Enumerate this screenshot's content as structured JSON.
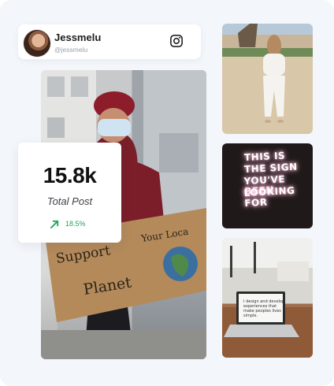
{
  "profile": {
    "name": "Jessmelu",
    "handle": "@jessmelu",
    "social_icon": "instagram-icon"
  },
  "stats": {
    "value": "15.8k",
    "label": "Total Post",
    "change": "18.5%",
    "trend_icon": "trend-up-arrow-icon",
    "trend_color": "#22a55a"
  },
  "gallery": {
    "neon_sign_lines": [
      "THIS IS",
      "THE SIGN",
      "YOU'VE BEEN",
      "LOOKING FOR"
    ],
    "sign_text": "Support Your Local Planet",
    "laptop_screen_text": "I design and develop experiences that make peoples lives simple."
  },
  "colors": {
    "panel_background": "#f3f6fa",
    "card_background": "#ffffff",
    "accent_green": "#22a55a"
  }
}
